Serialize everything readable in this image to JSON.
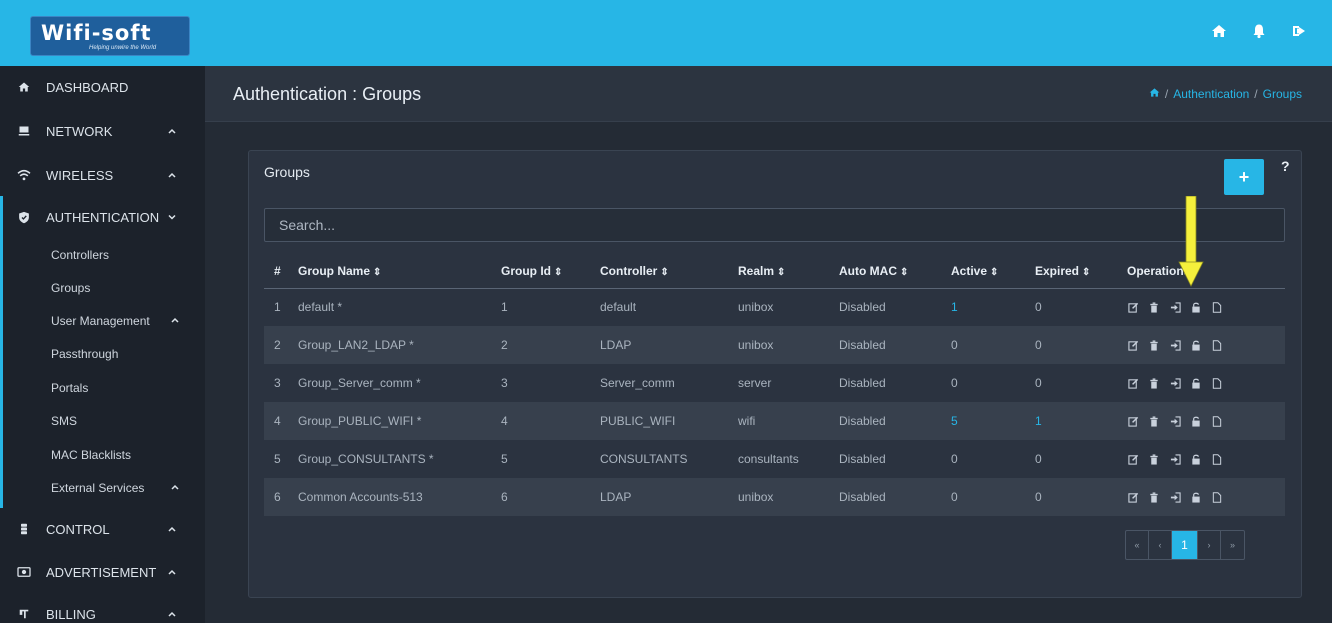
{
  "header": {
    "logo_text": "Wifi-soft",
    "logo_tagline": "Helping unwire the World",
    "icons": [
      "home-icon",
      "bell-icon",
      "logout-icon"
    ],
    "accent_color": "#27b6e6"
  },
  "sidebar": {
    "items": [
      {
        "label": "DASHBOARD",
        "icon": "home-icon"
      },
      {
        "label": "NETWORK",
        "icon": "monitor-icon"
      },
      {
        "label": "WIRELESS",
        "icon": "wifi-icon"
      },
      {
        "label": "AUTHENTICATION",
        "icon": "shield-icon"
      },
      {
        "label": "CONTROL",
        "icon": "control-icon"
      },
      {
        "label": "ADVERTISEMENT",
        "icon": "ad-icon"
      },
      {
        "label": "BILLING",
        "icon": "billing-icon"
      }
    ],
    "sub_items": [
      {
        "label": "Controllers"
      },
      {
        "label": "Groups"
      },
      {
        "label": "User Management"
      },
      {
        "label": "Passthrough"
      },
      {
        "label": "Portals"
      },
      {
        "label": "SMS"
      },
      {
        "label": "MAC Blacklists"
      },
      {
        "label": "External Services"
      }
    ]
  },
  "page": {
    "title": "Authentication : Groups",
    "breadcrumb": [
      "Authentication",
      "Groups"
    ],
    "breadcrumb_sep": "/"
  },
  "panel": {
    "title": "Groups",
    "add_label": "+",
    "help_label": "?",
    "search_placeholder": "Search..."
  },
  "table": {
    "columns": [
      "#",
      "Group Name",
      "Group Id",
      "Controller",
      "Realm",
      "Auto MAC",
      "Active",
      "Expired",
      "Operations"
    ],
    "sort_glyph": "⇕",
    "rows": [
      {
        "num": "1",
        "name": "default *",
        "id": "1",
        "controller": "default",
        "realm": "unibox",
        "auto_mac": "Disabled",
        "active": "1",
        "expired": "0"
      },
      {
        "num": "2",
        "name": "Group_LAN2_LDAP *",
        "id": "2",
        "controller": "LDAP",
        "realm": "unibox",
        "auto_mac": "Disabled",
        "active": "0",
        "expired": "0"
      },
      {
        "num": "3",
        "name": "Group_Server_comm *",
        "id": "3",
        "controller": "Server_comm",
        "realm": "server",
        "auto_mac": "Disabled",
        "active": "0",
        "expired": "0"
      },
      {
        "num": "4",
        "name": "Group_PUBLIC_WIFI *",
        "id": "4",
        "controller": "PUBLIC_WIFI",
        "realm": "wifi",
        "auto_mac": "Disabled",
        "active": "5",
        "expired": "1"
      },
      {
        "num": "5",
        "name": "Group_CONSULTANTS *",
        "id": "5",
        "controller": "CONSULTANTS",
        "realm": "consultants",
        "auto_mac": "Disabled",
        "active": "0",
        "expired": "0"
      },
      {
        "num": "6",
        "name": "Common Accounts-513",
        "id": "6",
        "controller": "LDAP",
        "realm": "unibox",
        "auto_mac": "Disabled",
        "active": "0",
        "expired": "0"
      }
    ],
    "operation_icons": [
      "edit-icon",
      "trash-icon",
      "sign-in-icon",
      "unlock-icon",
      "file-icon"
    ]
  },
  "pagination": {
    "first": "«",
    "prev": "‹",
    "current": "1",
    "next": "›",
    "last": "»"
  },
  "annotation": {
    "arrow_color": "#f5f03c"
  }
}
